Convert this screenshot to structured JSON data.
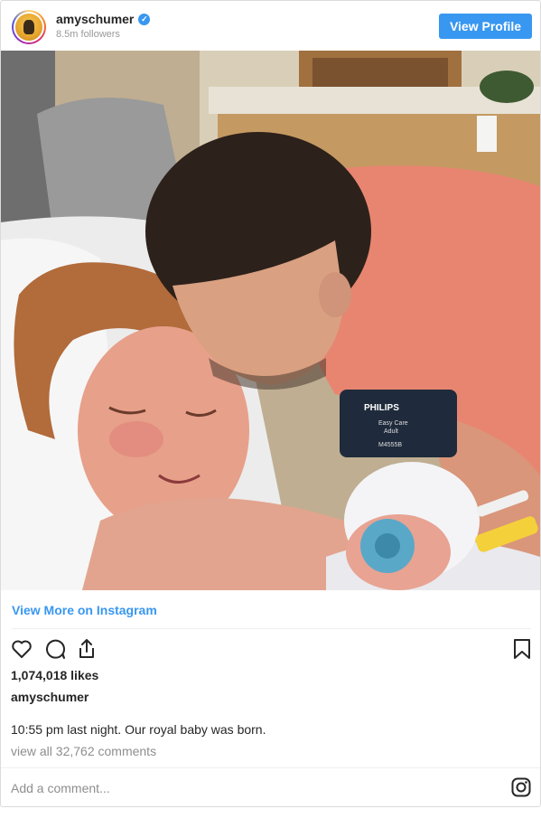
{
  "header": {
    "username": "amyschumer",
    "verified_glyph": "✓",
    "followers": "8.5m followers",
    "view_profile_label": "View Profile",
    "accent_color": "#3897f0"
  },
  "post": {
    "image_icon": "photo",
    "view_more_label": "View More on Instagram",
    "likes": "1,074,018 likes",
    "caption_username": "amyschumer",
    "caption_text": "10:55 pm last night. Our royal baby was born.",
    "view_all_comments": "view all 32,762 comments",
    "monitor_brand": "PHILIPS",
    "monitor_text_1": "Easy Care",
    "monitor_text_2": "Adult",
    "monitor_text_3": "M4555B"
  },
  "actions": {
    "like_icon": "heart-icon",
    "comment_icon": "comment-icon",
    "share_icon": "share-icon",
    "save_icon": "bookmark-icon"
  },
  "footer": {
    "add_comment_placeholder": "Add a comment...",
    "logo_icon": "instagram-icon"
  }
}
